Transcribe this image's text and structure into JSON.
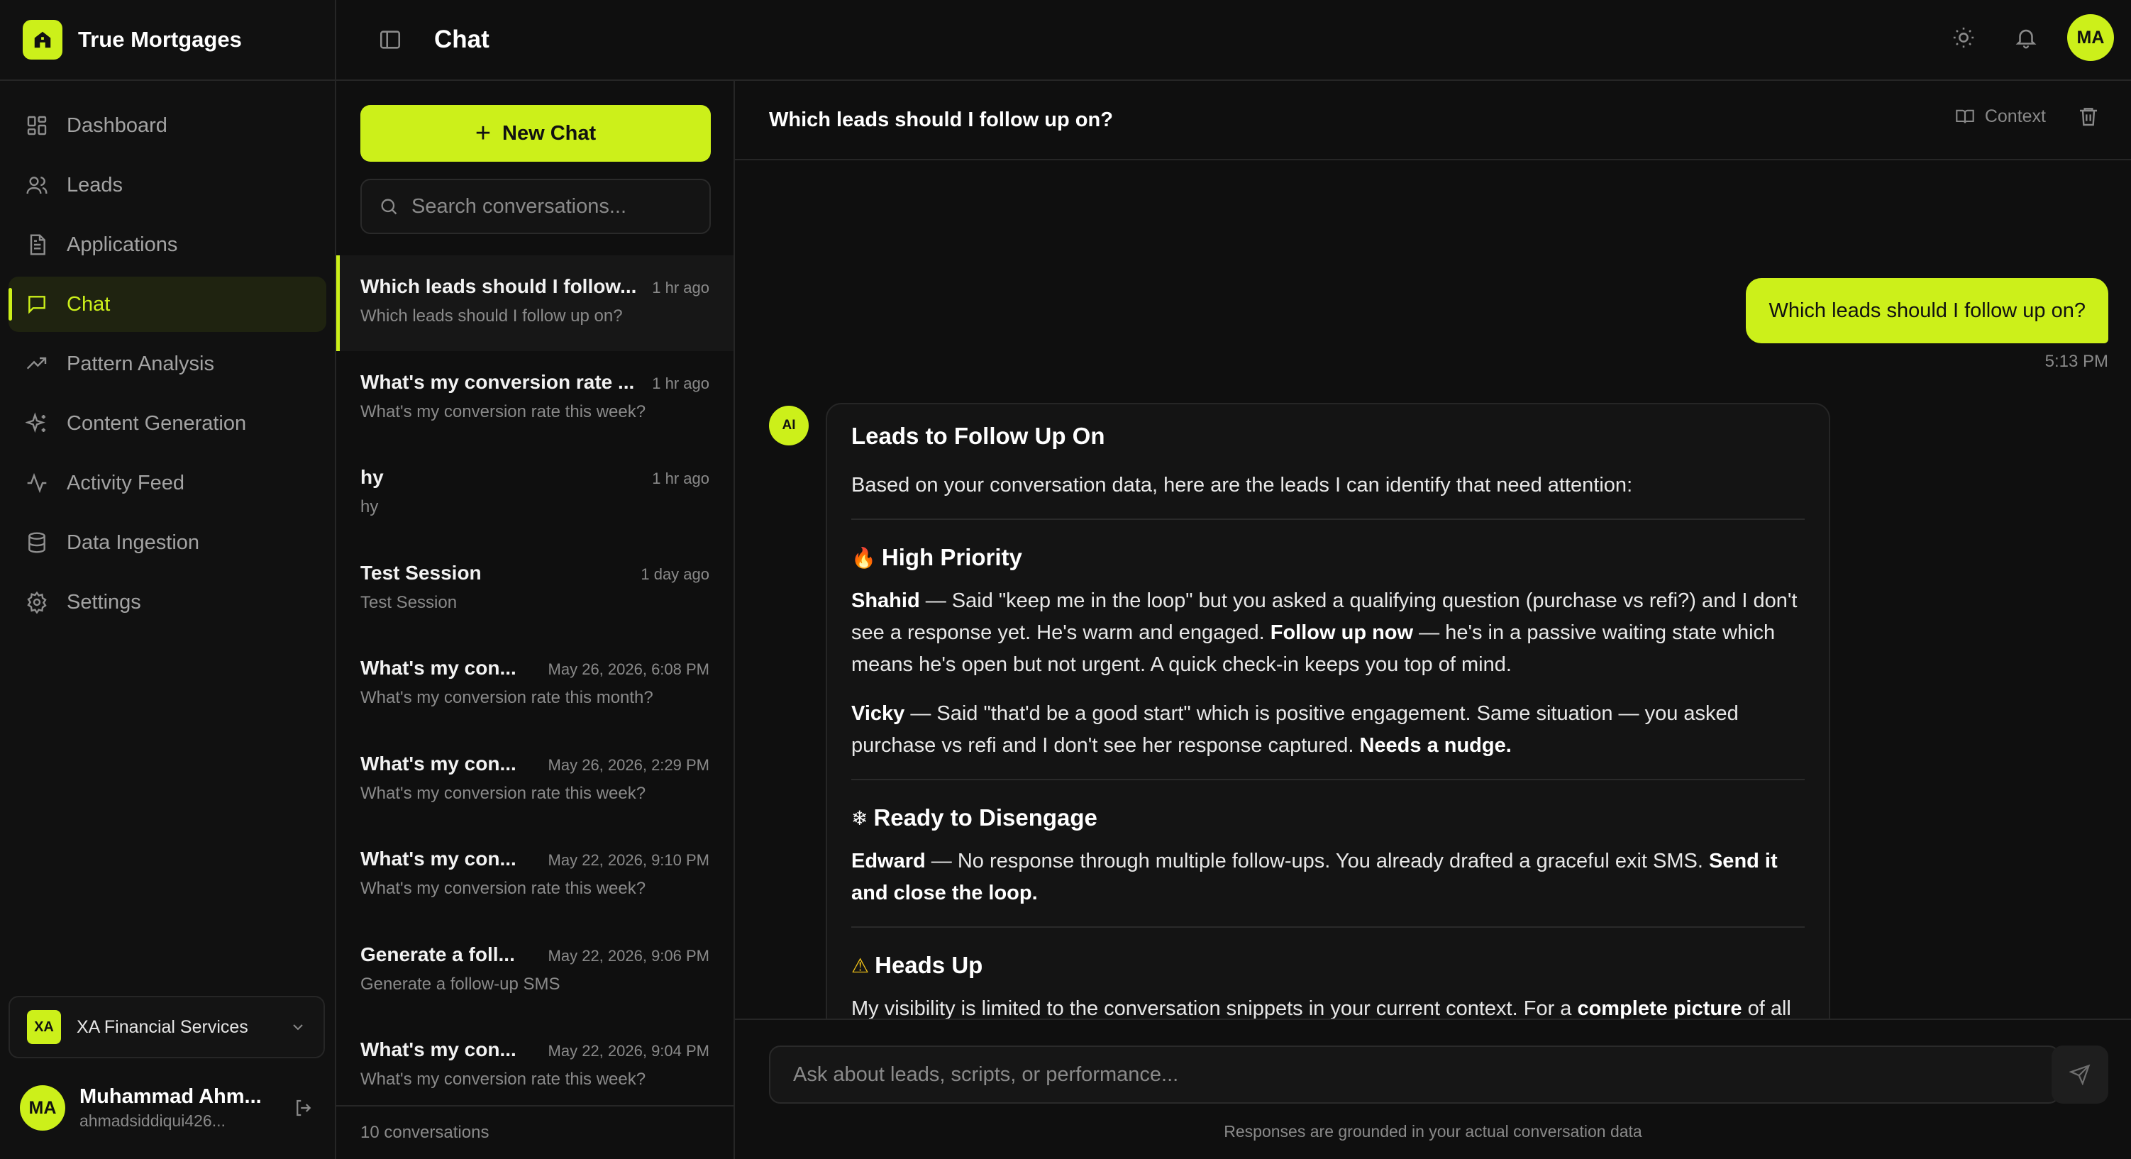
{
  "brand": {
    "name": "True Mortgages"
  },
  "nav": {
    "items": [
      {
        "label": "Dashboard",
        "icon": "dashboard-icon"
      },
      {
        "label": "Leads",
        "icon": "users-icon"
      },
      {
        "label": "Applications",
        "icon": "document-icon"
      },
      {
        "label": "Chat",
        "icon": "chat-icon",
        "active": true
      },
      {
        "label": "Pattern Analysis",
        "icon": "trend-icon"
      },
      {
        "label": "Content Generation",
        "icon": "sparkles-icon"
      },
      {
        "label": "Activity Feed",
        "icon": "activity-icon"
      },
      {
        "label": "Data Ingestion",
        "icon": "database-icon"
      },
      {
        "label": "Settings",
        "icon": "gear-icon"
      }
    ]
  },
  "org": {
    "badge": "XA",
    "name": "XA Financial Services"
  },
  "user": {
    "initials": "MA",
    "name": "Muhammad Ahm...",
    "email": "ahmadsiddiqui426..."
  },
  "topbar": {
    "title": "Chat",
    "avatar": "MA"
  },
  "convlist": {
    "new_chat_label": "New Chat",
    "search_placeholder": "Search conversations...",
    "items": [
      {
        "title": "Which leads should I follow...",
        "time": "1 hr ago",
        "preview": "Which leads should I follow up on?"
      },
      {
        "title": "What's my conversion rate ...",
        "time": "1 hr ago",
        "preview": "What's my conversion rate this week?"
      },
      {
        "title": "hy",
        "time": "1 hr ago",
        "preview": "hy"
      },
      {
        "title": "Test Session",
        "time": "1 day ago",
        "preview": "Test Session"
      },
      {
        "title": "What's my con...",
        "time": "May 26, 2026, 6:08 PM",
        "preview": "What's my conversion rate this month?"
      },
      {
        "title": "What's my con...",
        "time": "May 26, 2026, 2:29 PM",
        "preview": "What's my conversion rate this week?"
      },
      {
        "title": "What's my con...",
        "time": "May 22, 2026, 9:10 PM",
        "preview": "What's my conversion rate this week?"
      },
      {
        "title": "Generate a foll...",
        "time": "May 22, 2026, 9:06 PM",
        "preview": "Generate a follow-up SMS"
      },
      {
        "title": "What's my con...",
        "time": "May 22, 2026, 9:04 PM",
        "preview": "What's my conversion rate this week?"
      }
    ],
    "footer": "10 conversations"
  },
  "chat": {
    "title": "Which leads should I follow up on?",
    "context_label": "Context",
    "user_message": "Which leads should I follow up on?",
    "user_time": "5:13 PM",
    "ai_badge": "AI",
    "ai": {
      "heading": "Leads to Follow Up On",
      "intro": "Based on your conversation data, here are the leads I can identify that need attention:",
      "high_priority": {
        "emoji": "🔥",
        "title": "High Priority",
        "shahid_name": "Shahid",
        "shahid_text1": " — Said \"keep me in the loop\" but you asked a qualifying question (purchase vs refi?) and I don't see a response yet. He's warm and engaged. ",
        "shahid_bold": "Follow up now",
        "shahid_text2": " — he's in a passive waiting state which means he's open but not urgent. A quick check-in keeps you top of mind.",
        "vicky_name": "Vicky",
        "vicky_text": " — Said \"that'd be a good start\" which is positive engagement. Same situation — you asked purchase vs refi and I don't see her response captured. ",
        "vicky_bold": "Needs a nudge."
      },
      "disengage": {
        "emoji": "❄",
        "title": "Ready to Disengage",
        "edward_name": "Edward",
        "edward_text": " — No response through multiple follow-ups. You already drafted a graceful exit SMS. ",
        "edward_bold": "Send it and close the loop."
      },
      "heads_up": {
        "emoji": "⚠",
        "title": "Heads Up",
        "text1": "My visibility is limited to the conversation snippets in your current context. For a ",
        "bold": "complete picture",
        "text2": " of all leads needing follow-up, I'd want to pull from your full lead list."
      }
    },
    "composer_placeholder": "Ask about leads, scripts, or performance...",
    "composer_note": "Responses are grounded in your actual conversation data"
  },
  "colors": {
    "accent": "#ccf01a",
    "background": "#0f0f0f",
    "border": "#262626",
    "muted": "#8a8a8a"
  }
}
